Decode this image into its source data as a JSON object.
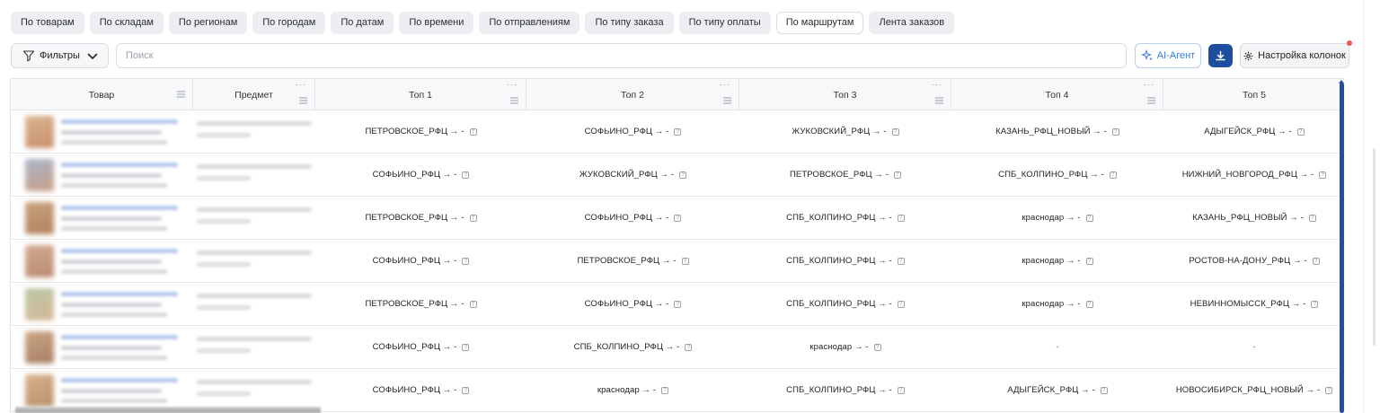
{
  "tabs": [
    {
      "label": "По товарам",
      "active": false
    },
    {
      "label": "По складам",
      "active": false
    },
    {
      "label": "По регионам",
      "active": false
    },
    {
      "label": "По городам",
      "active": false
    },
    {
      "label": "По датам",
      "active": false
    },
    {
      "label": "По времени",
      "active": false
    },
    {
      "label": "По отправлениям",
      "active": false
    },
    {
      "label": "По типу заказа",
      "active": false
    },
    {
      "label": "По типу оплаты",
      "active": false
    },
    {
      "label": "По маршрутам",
      "active": true
    },
    {
      "label": "Лента заказов",
      "active": false
    }
  ],
  "toolbar": {
    "filters_label": "Фильтры",
    "search_placeholder": "Поиск",
    "ai_label": "AI-Агент",
    "columns_label": "Настройка колонок"
  },
  "colors": {
    "accent": "#1d4f9e",
    "ai": "#3f7ae0",
    "notify": "#e85a4f"
  },
  "table": {
    "columns": [
      "Товар",
      "Предмет",
      "Топ 1",
      "Топ 2",
      "Топ 3",
      "Топ 4",
      "Топ 5"
    ],
    "rows": [
      [
        "ПЕТРОВСКОЕ_РФЦ → -",
        "СОФЬИНО_РФЦ → -",
        "ЖУКОВСКИЙ_РФЦ → -",
        "КАЗАНЬ_РФЦ_НОВЫЙ → -",
        "АДЫГЕЙСК_РФЦ → -"
      ],
      [
        "СОФЬИНО_РФЦ → -",
        "ЖУКОВСКИЙ_РФЦ → -",
        "ПЕТРОВСКОЕ_РФЦ → -",
        "СПБ_КОЛПИНО_РФЦ → -",
        "НИЖНИЙ_НОВГОРОД_РФЦ → -"
      ],
      [
        "ПЕТРОВСКОЕ_РФЦ → -",
        "СОФЬИНО_РФЦ → -",
        "СПБ_КОЛПИНО_РФЦ → -",
        "краснодар → -",
        "КАЗАНЬ_РФЦ_НОВЫЙ → -"
      ],
      [
        "СОФЬИНО_РФЦ → -",
        "ПЕТРОВСКОЕ_РФЦ → -",
        "СПБ_КОЛПИНО_РФЦ → -",
        "краснодар → -",
        "РОСТОВ-НА-ДОНУ_РФЦ → -"
      ],
      [
        "ПЕТРОВСКОЕ_РФЦ → -",
        "СОФЬИНО_РФЦ → -",
        "СПБ_КОЛПИНО_РФЦ → -",
        "краснодар → -",
        "НЕВИННОМЫССК_РФЦ → -"
      ],
      [
        "СОФЬИНО_РФЦ → -",
        "СПБ_КОЛПИНО_РФЦ → -",
        "краснодар → -",
        "-",
        "-"
      ],
      [
        "СОФЬИНО_РФЦ → -",
        "краснодар → -",
        "СПБ_КОЛПИНО_РФЦ → -",
        "АДЫГЕЙСК_РФЦ → -",
        "НОВОСИБИРСК_РФЦ_НОВЫЙ → -"
      ]
    ]
  }
}
